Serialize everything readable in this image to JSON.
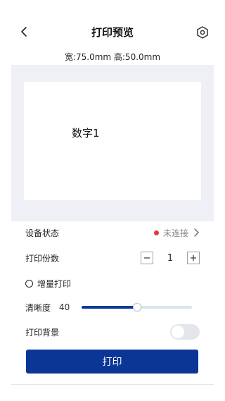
{
  "header": {
    "title": "打印预览"
  },
  "label_size": "宽:75.0mm 高:50.0mm",
  "canvas": {
    "text": "数字1"
  },
  "settings": {
    "device_status_label": "设备状态",
    "device_status_value": "未连接",
    "status_color": "#e53935",
    "copies_label": "打印份数",
    "copies_value": "1",
    "incremental_label": "增量打印",
    "clarity_label": "清晰度",
    "clarity_value": "40",
    "clarity_fraction": 0.5,
    "background_label": "打印背景",
    "background_on": false
  },
  "print_button": "打印",
  "colors": {
    "accent": "#0b3696",
    "preview_bg": "#eef0f5"
  },
  "icons": {
    "back": "chevron-left-icon",
    "settings": "gear-icon",
    "status_arrow": "chevron-right-icon"
  }
}
